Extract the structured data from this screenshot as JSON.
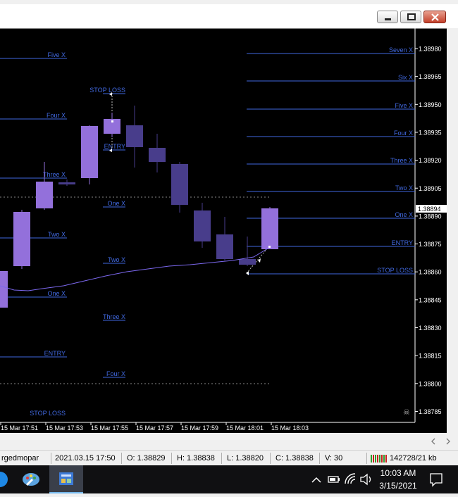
{
  "window": {
    "buttons": [
      "minimize",
      "maximize",
      "close"
    ]
  },
  "chart": {
    "price_scale": [
      "1.38980",
      "1.38965",
      "1.38950",
      "1.38935",
      "1.38920",
      "1.38905",
      "1.38890",
      "1.38875",
      "1.38860",
      "1.38845",
      "1.38830",
      "1.38815",
      "1.38800",
      "1.38785"
    ],
    "current_price": "1.38894",
    "time_labels": [
      "15 Mar 17:51",
      "15 Mar 17:53",
      "15 Mar 17:55",
      "15 Mar 17:57",
      "15 Mar 17:59",
      "15 Mar 18:01",
      "15 Mar 18:03"
    ],
    "right_levels": [
      "Seven X",
      "Six X",
      "Five X",
      "Four X",
      "Three X",
      "Two X",
      "One X",
      "ENTRY",
      "STOP LOSS"
    ],
    "left_levels": [
      "Five X",
      "Four X",
      "Three X",
      "Two X",
      "One X",
      "ENTRY",
      "STOP LOSS"
    ],
    "mid_levels": [
      "STOP LOSS",
      "ENTRY",
      "One X",
      "Two X",
      "Three X",
      "Four X"
    ],
    "colors": {
      "bull": "#9370db",
      "bear": "#483d8b",
      "level": "#4169e1",
      "label": "#4169e1",
      "ma": "#7b68ee"
    }
  },
  "statusbar": {
    "profile": "rgedmopar",
    "datetime": "2021.03.15 17:50",
    "open": "O: 1.38829",
    "high": "H: 1.38838",
    "low": "L: 1.38820",
    "close": "C: 1.38838",
    "volume": "V: 30",
    "traffic": "142728/21 kb"
  },
  "taskbar": {
    "time": "10:03 AM",
    "date": "3/15/2021",
    "icons": [
      "start-icon",
      "paint-icon",
      "app-icon",
      "chevron-up-icon",
      "battery-icon",
      "wifi-icon",
      "speaker-icon",
      "notification-icon"
    ]
  }
}
